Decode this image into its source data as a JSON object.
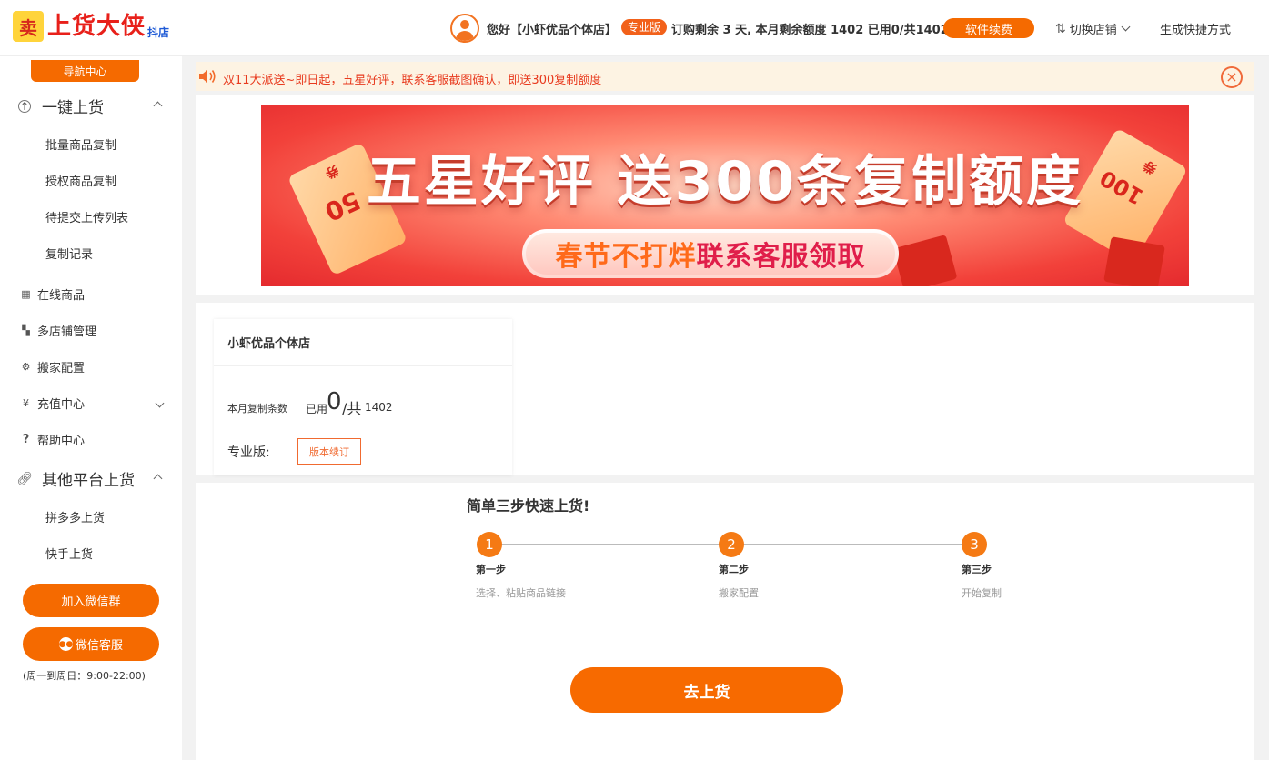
{
  "header": {
    "logo_text": "上货大侠",
    "logo_sub": "抖店",
    "greeting": "您好【小虾优品个体店】",
    "edition_badge": "专业版",
    "subscription": "订购剩余 3 天, 本月剩余额度 1402 已用0/共1402",
    "renew_label": "软件续费",
    "switch_shop_label": "切换店铺",
    "shortcut_label": "生成快捷方式"
  },
  "sidebar": {
    "nav_center": "导航中心",
    "groups": [
      {
        "label": "一键上货",
        "icon": "upload-icon",
        "subitems": [
          "批量商品复制",
          "授权商品复制",
          "待提交上传列表",
          "复制记录"
        ]
      },
      {
        "label": "其他平台上货",
        "icon": "link-icon",
        "subitems": [
          "拼多多上货",
          "快手上货"
        ]
      }
    ],
    "items": [
      {
        "label": "在线商品",
        "icon": "table-icon"
      },
      {
        "label": "多店铺管理",
        "icon": "grid-icon"
      },
      {
        "label": "搬家配置",
        "icon": "gear-icon"
      },
      {
        "label": "充值中心",
        "icon": "yen-icon"
      },
      {
        "label": "帮助中心",
        "icon": "question-icon"
      }
    ],
    "join_wechat_group": "加入微信群",
    "wechat_service": "微信客服",
    "service_hours": "(周一到周日：9:00-22:00)"
  },
  "notice": {
    "text": "双11大派送~即日起，五星好评，联系客服截图确认，即送300复制额度"
  },
  "banner": {
    "title": "五星好评 送300条复制额度",
    "button_highlight": "春节不打烊",
    "button_rest": "联系客服领取",
    "ticket_left": "50",
    "ticket_left_tag": "券",
    "ticket_right": "100",
    "ticket_right_tag": "券"
  },
  "shop": {
    "name": "小虾优品个体店",
    "quota_label": "本月复制条数",
    "used_label": "已用",
    "used": "0",
    "total_label": "/共",
    "total": "1402",
    "edition_label": "专业版:",
    "edition_button": "版本续订"
  },
  "steps": {
    "title": "简单三步快速上货!",
    "items": [
      {
        "num": "1",
        "name": "第一步",
        "desc": "选择、粘贴商品链接"
      },
      {
        "num": "2",
        "name": "第二步",
        "desc": "搬家配置"
      },
      {
        "num": "3",
        "name": "第三步",
        "desc": "开始复制"
      }
    ],
    "go_button": "去上货"
  },
  "colors": {
    "accent": "#f56a00",
    "notice_bg": "#fdf3e3",
    "notice_text": "#e83a1e",
    "banner_red": "#e42a2e"
  }
}
